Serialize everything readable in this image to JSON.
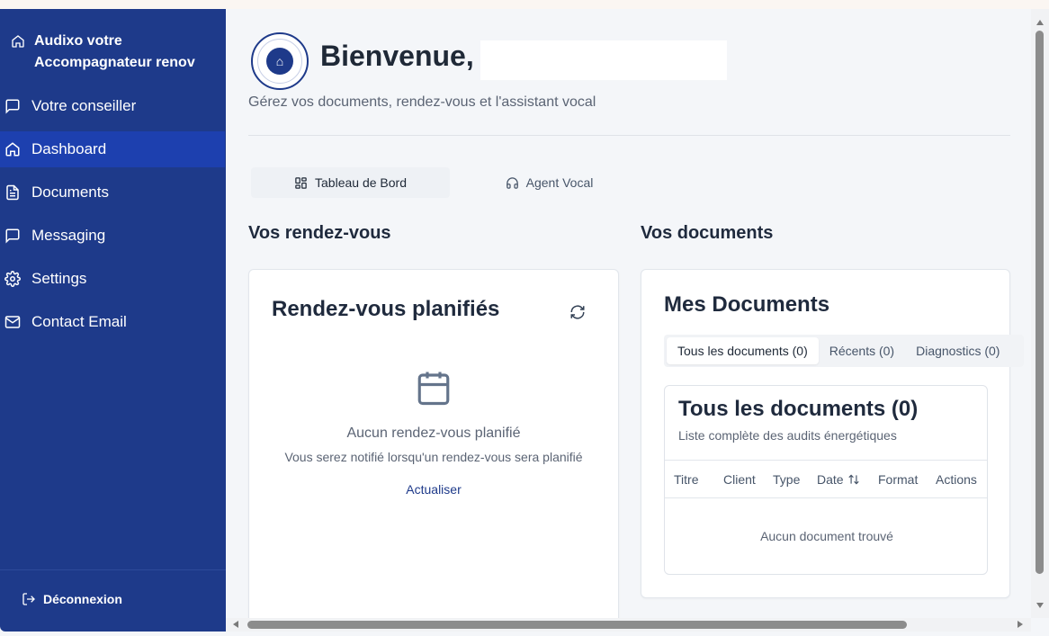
{
  "sidebar": {
    "brand": "Audixo votre Accompagnateur renov",
    "items": [
      {
        "label": "Votre conseiller",
        "icon": "message-square-icon"
      },
      {
        "label": "Dashboard",
        "icon": "home-icon",
        "active": true
      },
      {
        "label": "Documents",
        "icon": "file-text-icon"
      },
      {
        "label": "Messaging",
        "icon": "message-square-icon"
      },
      {
        "label": "Settings",
        "icon": "gear-icon"
      },
      {
        "label": "Contact Email",
        "icon": "mail-icon"
      }
    ],
    "logout": "Déconnexion"
  },
  "header": {
    "welcome": "Bienvenue,",
    "subtitle": "Gérez vos documents, rendez-vous et l'assistant vocal"
  },
  "tabs": [
    {
      "label": "Tableau de Bord",
      "icon": "grid-icon",
      "active": true
    },
    {
      "label": "Agent Vocal",
      "icon": "headphones-icon",
      "active": false
    }
  ],
  "appointments": {
    "section_title": "Vos rendez-vous",
    "card_title": "Rendez-vous planifiés",
    "empty_title": "Aucun rendez-vous planifié",
    "empty_sub": "Vous serez notifié lorsqu'un rendez-vous sera planifié",
    "refresh_label": "Actualiser"
  },
  "documents": {
    "section_title": "Vos documents",
    "card_title": "Mes Documents",
    "tabs": [
      "Tous les documents (0)",
      "Récents (0)",
      "Diagnostics (0)"
    ],
    "inner_title": "Tous les documents (0)",
    "inner_sub": "Liste complète des audits énergétiques",
    "columns": [
      "Titre",
      "Client",
      "Type",
      "Date",
      "Format",
      "Actions"
    ],
    "empty": "Aucun document trouvé"
  },
  "colors": {
    "sidebar_bg": "#1e3a8a",
    "sidebar_active": "#1d40af",
    "accent": "#1e3a8a"
  }
}
